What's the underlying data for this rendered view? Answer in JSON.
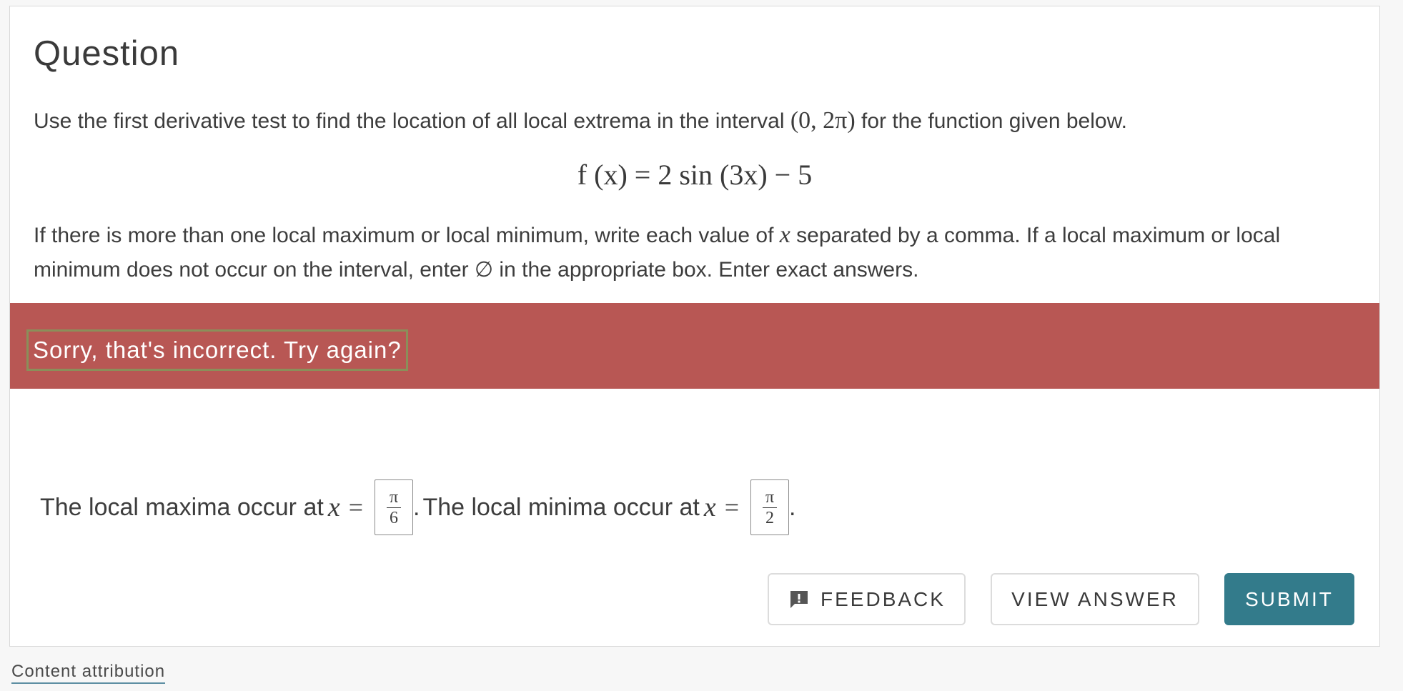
{
  "question": {
    "title": "Question",
    "intro_before": "Use the first derivative test to find the location of all local extrema in the interval ",
    "interval": "(0, 2π)",
    "intro_after": " for the function given below.",
    "equation": "f (x) = 2 sin (3x) − 5",
    "instructions_1": "If there is more than one local maximum or local minimum, write each value of ",
    "instructions_var": "x",
    "instructions_2": " separated by a comma. If a local maximum or local minimum does not occur on the interval, enter ∅ in the appropriate box. Enter exact answers."
  },
  "feedback_banner": {
    "message": "Sorry, that's incorrect. Try again?",
    "color": "#b85754"
  },
  "answers": {
    "max_label": "The local maxima occur at",
    "min_label": "The local minima occur at",
    "var": "x",
    "equals": "=",
    "period": ".",
    "max_value": {
      "numerator": "π",
      "denominator": "6"
    },
    "min_value": {
      "numerator": "π",
      "denominator": "2"
    }
  },
  "buttons": {
    "feedback": "FEEDBACK",
    "view_answer": "VIEW ANSWER",
    "submit": "SUBMIT",
    "submit_color": "#337b8b",
    "feedback_icon": "feedback-icon"
  },
  "footer": {
    "attribution": "Content attribution"
  }
}
